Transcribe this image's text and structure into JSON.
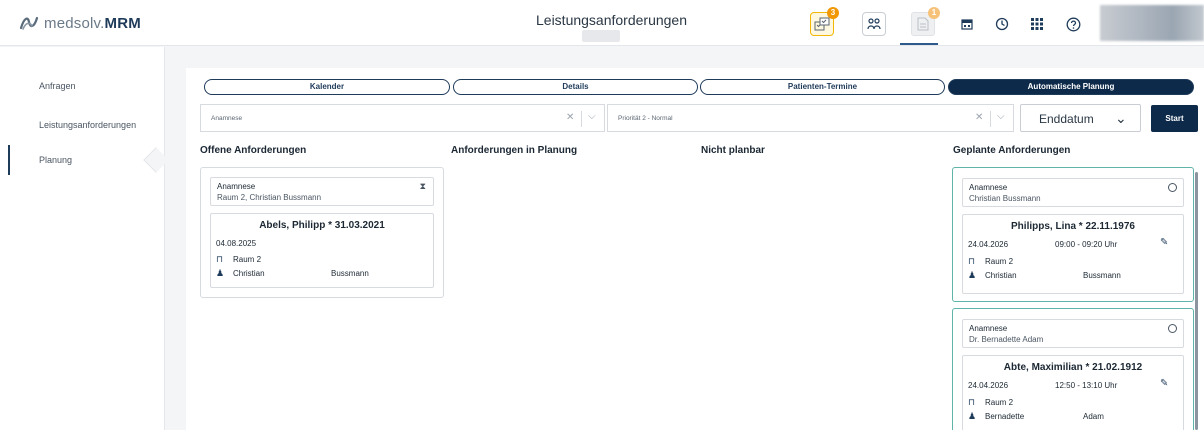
{
  "app": {
    "logo_prefix": "medsolv.",
    "logo_bold": "MRM",
    "title": "Leistungsanforderungen"
  },
  "header_icons": [
    {
      "name": "assignment-icon",
      "badge": "3"
    },
    {
      "name": "patients-icon"
    },
    {
      "name": "document-icon",
      "badge": "1"
    },
    {
      "name": "calendar-icon"
    },
    {
      "name": "clock-icon"
    },
    {
      "name": "grid-icon"
    },
    {
      "name": "help-icon"
    }
  ],
  "sidebar": {
    "items": [
      {
        "label": "Anfragen"
      },
      {
        "label": "Leistungsanforderungen"
      },
      {
        "label": "Planung"
      }
    ]
  },
  "tabs": [
    {
      "label": "Kalender"
    },
    {
      "label": "Details"
    },
    {
      "label": "Patienten-Termine"
    },
    {
      "label": "Automatische Planung"
    }
  ],
  "filters": {
    "type_value": "Anamnese",
    "priority_value": "Priorität 2 - Normal",
    "enddate_label": "Enddatum",
    "start_label": "Start"
  },
  "columns": {
    "open": "Offene Anforderungen",
    "in_planning": "Anforderungen in Planung",
    "not_plannable": "Nicht planbar",
    "planned": "Geplante Anforderungen"
  },
  "open_cards": [
    {
      "type": "Anamnese",
      "sub": "Raum 2, Christian Bussmann",
      "patient": "Abels, Philipp * 31.03.2021",
      "date": "04.08.2025",
      "room": "Raum 2",
      "first": "Christian",
      "last": "Bussmann"
    }
  ],
  "planned_cards": [
    {
      "type": "Anamnese",
      "sub": "Christian Bussmann",
      "patient": "Philipps, Lina * 22.11.1976",
      "date": "24.04.2026",
      "time": "09:00 - 09:20 Uhr",
      "room": "Raum 2",
      "first": "Christian",
      "last": "Bussmann"
    },
    {
      "type": "Anamnese",
      "sub": "Dr. Bernadette Adam",
      "patient": "Abte, Maximilian * 21.02.1912",
      "date": "24.04.2026",
      "time": "12:50 - 13:10 Uhr",
      "room": "Raum 2",
      "first": "Bernadette",
      "last": "Adam"
    }
  ],
  "colors": {
    "primary": "#0e2a4a",
    "accent_badge": "#f29705",
    "teal_border": "#5fb3a8"
  }
}
